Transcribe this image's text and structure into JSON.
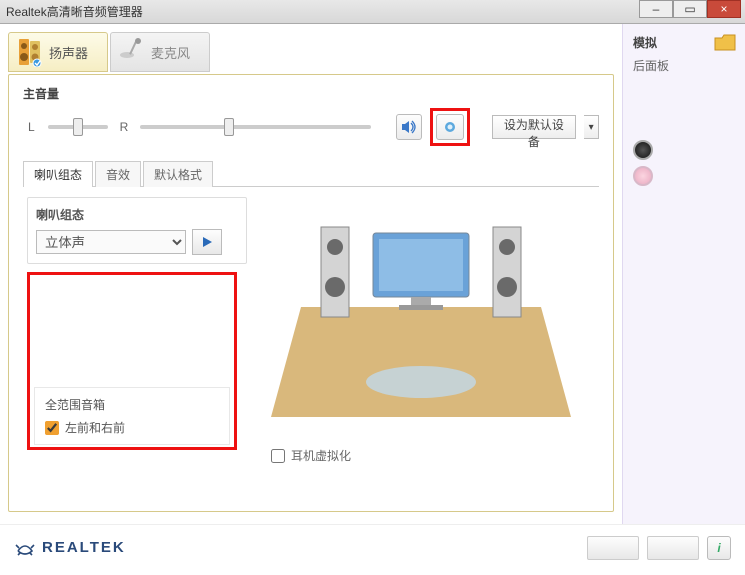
{
  "window": {
    "title": "Realtek高清晰音频管理器"
  },
  "tabs": {
    "speaker_label": "扬声器",
    "mic_label": "麦克风"
  },
  "volume": {
    "section_label": "主音量",
    "left_label": "L",
    "right_label": "R",
    "default_btn_label": "设为默认设备"
  },
  "subtabs": {
    "config": "喇叭组态",
    "effects": "音效",
    "format": "默认格式"
  },
  "config": {
    "title": "喇叭组态",
    "select_value": "立体声",
    "fullrange_title": "全范围音箱",
    "fullrange_option": "左前和右前",
    "headphone_virt": "耳机虚拟化"
  },
  "side": {
    "title": "模拟",
    "back_label": "后面板"
  },
  "logo": {
    "text": "REALTEK"
  },
  "icons": {
    "vol": "volume-icon",
    "blue": "device-advanced-settings-icon",
    "play": "play-icon"
  }
}
